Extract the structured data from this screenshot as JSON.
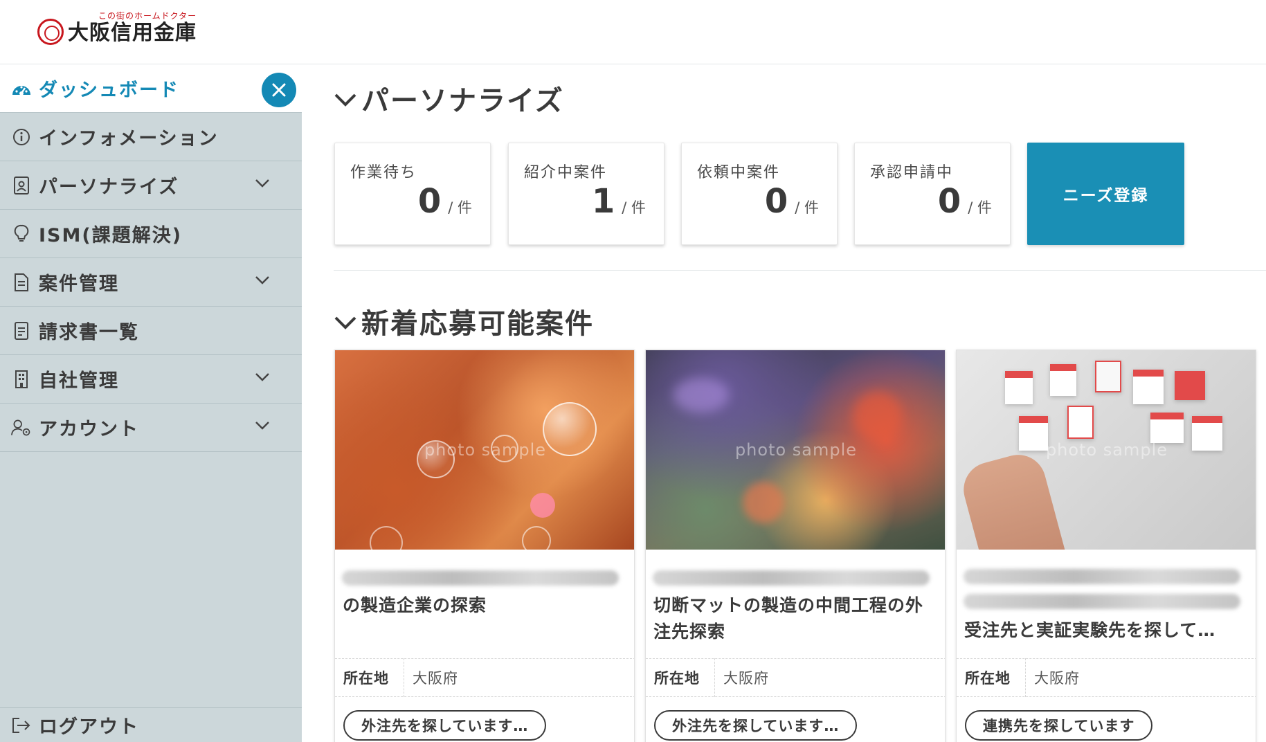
{
  "header": {
    "logo_tagline": "この街のホームドクター",
    "logo_name": "大阪信用金庫"
  },
  "sidebar": {
    "items": [
      {
        "label": "ダッシュボード",
        "icon": "dashboard-icon",
        "active": true
      },
      {
        "label": "インフォメーション",
        "icon": "info-icon"
      },
      {
        "label": "パーソナライズ",
        "icon": "person-document-icon",
        "expandable": true
      },
      {
        "label": "ISM(課題解決)",
        "icon": "lightbulb-icon"
      },
      {
        "label": "案件管理",
        "icon": "document-icon",
        "expandable": true
      },
      {
        "label": "請求書一覧",
        "icon": "invoice-icon"
      },
      {
        "label": "自社管理",
        "icon": "building-icon",
        "expandable": true
      },
      {
        "label": "アカウント",
        "icon": "user-settings-icon",
        "expandable": true
      }
    ],
    "logout_label": "ログアウト"
  },
  "main": {
    "personalize_title": "パーソナライズ",
    "stats": [
      {
        "label": "作業待ち",
        "value": "0",
        "unit": "/ 件"
      },
      {
        "label": "紹介中案件",
        "value": "1",
        "unit": "/ 件"
      },
      {
        "label": "依頼中案件",
        "value": "0",
        "unit": "/ 件"
      },
      {
        "label": "承認申請中",
        "value": "0",
        "unit": "/ 件"
      }
    ],
    "needs_button": "ニーズ登録",
    "new_projects_title": "新着応募可能案件",
    "location_label": "所在地",
    "watermark": "photo sample",
    "cards": [
      {
        "title": "の製造企業の探索",
        "location": "大阪府",
        "tag": "外注先を探しています…"
      },
      {
        "title": "切断マットの製造の中間工程の外注先探索",
        "location": "大阪府",
        "tag": "外注先を探しています…"
      },
      {
        "title": "受注先と実証実験先を探して…",
        "location": "大阪府",
        "tag": "連携先を探しています"
      }
    ]
  },
  "colors": {
    "accent": "#1489b5",
    "sidebar_bg": "#ccd7da",
    "brand_red": "#c8161d"
  }
}
